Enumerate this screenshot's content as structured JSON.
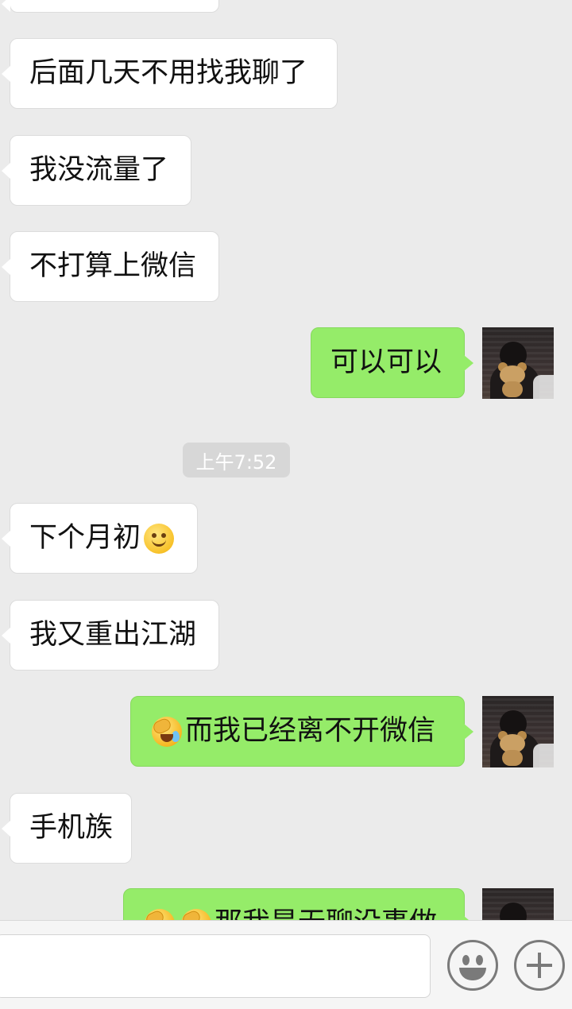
{
  "messages": [
    {
      "from": "other",
      "text": ""
    },
    {
      "from": "other",
      "text": "后面几天不用找我聊了"
    },
    {
      "from": "other",
      "text": "我没流量了"
    },
    {
      "from": "other",
      "text": "不打算上微信"
    },
    {
      "from": "self",
      "text": "可以可以"
    },
    {
      "from": "other",
      "text": "下个月初",
      "emoji": "smiling-face-icon"
    },
    {
      "from": "other",
      "text": "我又重出江湖"
    },
    {
      "from": "self",
      "text": "而我已经离不开微信",
      "emoji": "crying-laughing-face-icon"
    },
    {
      "from": "other",
      "text": "手机族"
    },
    {
      "from": "self",
      "text": "那我是无聊没事做",
      "emoji": "crying-laughing-face-icon"
    }
  ],
  "timestamp": "上午7:52",
  "input_bar": {
    "text_value": "",
    "emoji_button_icon": "smiley-icon",
    "more_button_icon": "plus-icon"
  },
  "colors": {
    "background": "#ebebeb",
    "incoming_bubble": "#ffffff",
    "outgoing_bubble": "#95ec69",
    "timestamp_bg": "#d7d7d7"
  }
}
